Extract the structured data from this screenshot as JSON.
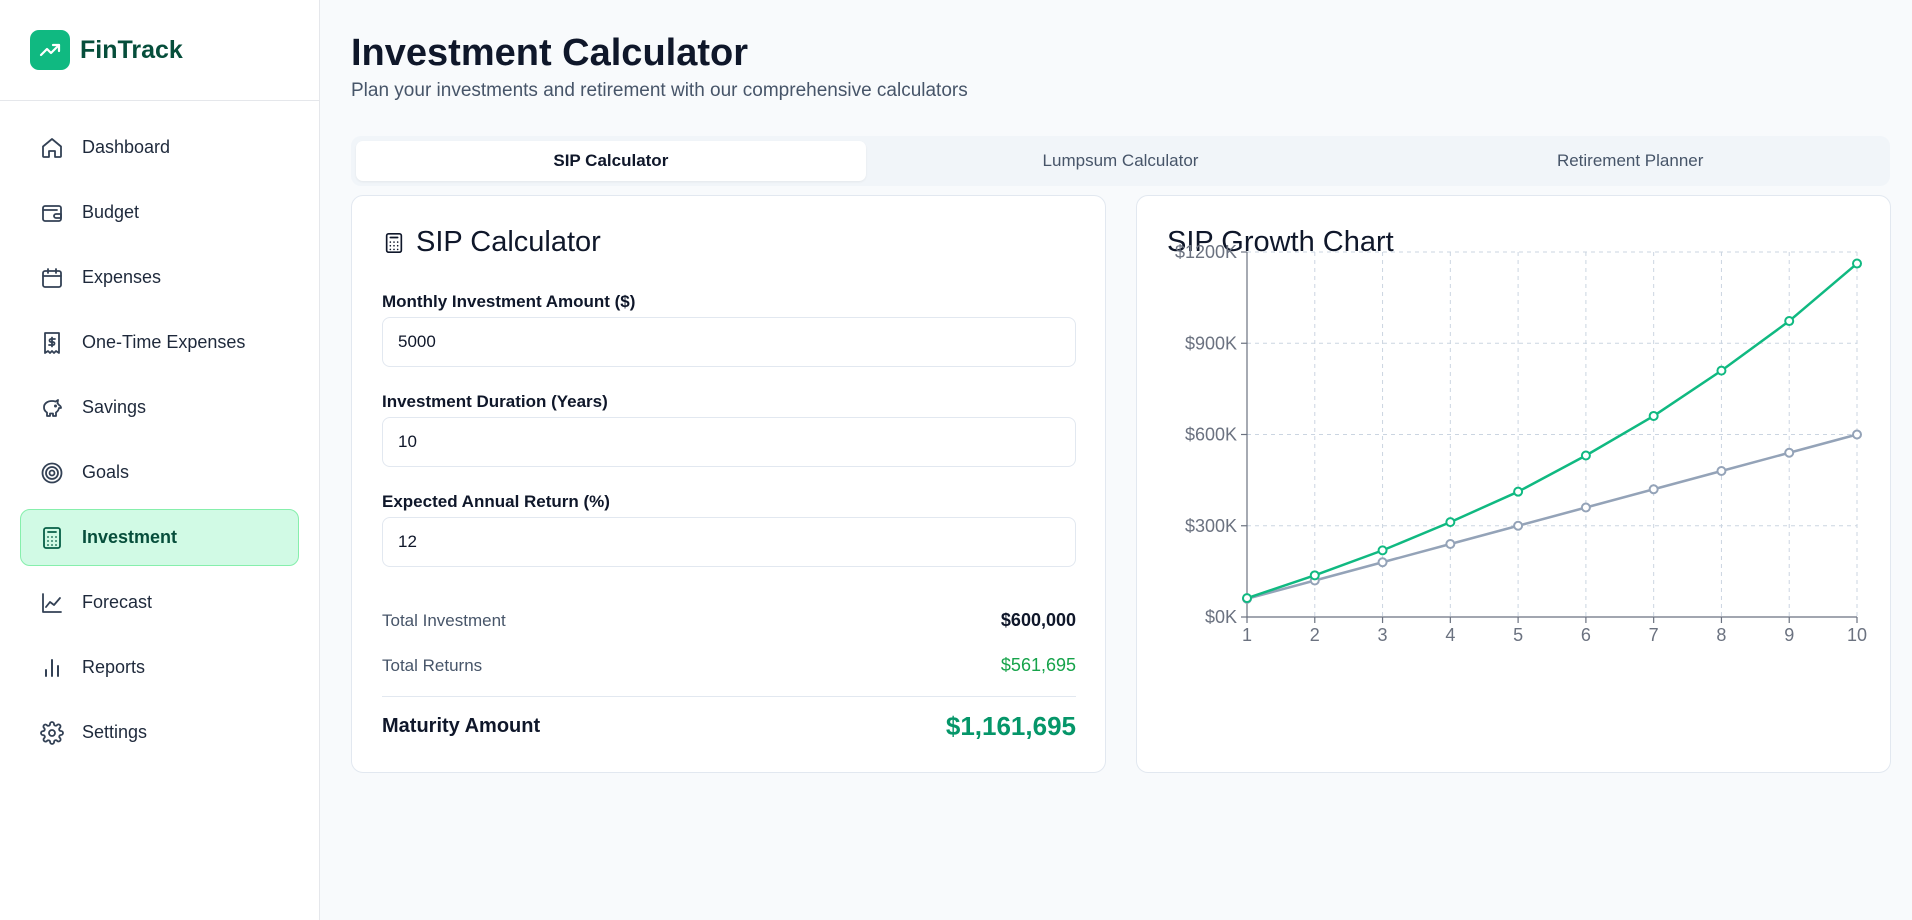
{
  "app": {
    "name": "FinTrack"
  },
  "sidebar": {
    "items": [
      {
        "label": "Dashboard",
        "icon": "home-icon",
        "active": false
      },
      {
        "label": "Budget",
        "icon": "wallet-icon",
        "active": false
      },
      {
        "label": "Expenses",
        "icon": "calendar-icon",
        "active": false
      },
      {
        "label": "One-Time Expenses",
        "icon": "receipt-dollar-icon",
        "active": false
      },
      {
        "label": "Savings",
        "icon": "piggy-bank-icon",
        "active": false
      },
      {
        "label": "Goals",
        "icon": "target-icon",
        "active": false
      },
      {
        "label": "Investment",
        "icon": "calculator-icon",
        "active": true
      },
      {
        "label": "Forecast",
        "icon": "line-chart-icon",
        "active": false
      },
      {
        "label": "Reports",
        "icon": "bar-chart-icon",
        "active": false
      },
      {
        "label": "Settings",
        "icon": "gear-icon",
        "active": false
      }
    ]
  },
  "page": {
    "title": "Investment Calculator",
    "subtitle": "Plan your investments and retirement with our comprehensive calculators"
  },
  "tabs": [
    {
      "label": "SIP Calculator",
      "active": true
    },
    {
      "label": "Lumpsum Calculator",
      "active": false
    },
    {
      "label": "Retirement Planner",
      "active": false
    }
  ],
  "calculator": {
    "title": "SIP Calculator",
    "fields": [
      {
        "label": "Monthly Investment Amount ($)",
        "value": "5000"
      },
      {
        "label": "Investment Duration (Years)",
        "value": "10"
      },
      {
        "label": "Expected Annual Return (%)",
        "value": "12"
      }
    ],
    "summary": {
      "total_investment_label": "Total Investment",
      "total_investment_value": "$600,000",
      "total_returns_label": "Total Returns",
      "total_returns_value": "$561,695",
      "maturity_label": "Maturity Amount",
      "maturity_value": "$1,161,695"
    }
  },
  "chart_card": {
    "title": "SIP Growth Chart"
  },
  "chart_data": {
    "type": "line",
    "x": [
      1,
      2,
      3,
      4,
      5,
      6,
      7,
      8,
      9,
      10
    ],
    "xlabel": "",
    "ylabel": "",
    "ylim": [
      0,
      1200000
    ],
    "yticks": [
      0,
      300000,
      600000,
      900000,
      1200000
    ],
    "ytick_labels": [
      "$0K",
      "$300K",
      "$600K",
      "$900K",
      "$1200K"
    ],
    "grid": true,
    "grid_style": "dashed",
    "series": [
      {
        "color": "#10b981",
        "values": [
          62000,
          137000,
          219000,
          312000,
          412000,
          531000,
          661000,
          810000,
          973000,
          1162000
        ]
      },
      {
        "color": "#94a3b8",
        "values": [
          60000,
          120000,
          180000,
          240000,
          300000,
          360000,
          420000,
          480000,
          540000,
          600000
        ]
      }
    ]
  },
  "colors": {
    "accent": "#10b981",
    "accent_dark": "#064e3b",
    "active_nav_bg": "#d1fae5",
    "positive": "#16a34a",
    "maturity": "#059669"
  }
}
